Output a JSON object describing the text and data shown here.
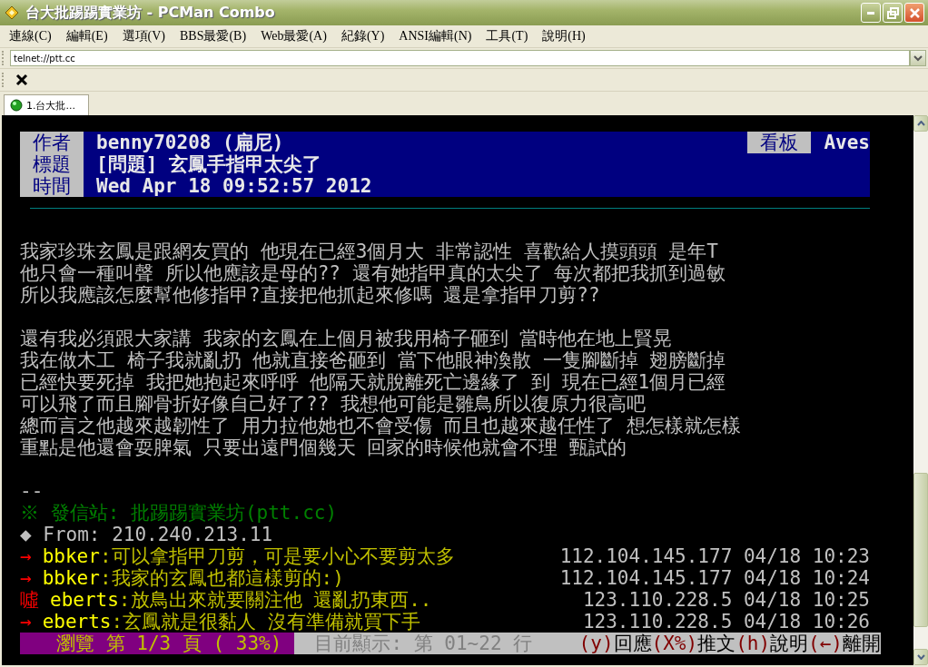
{
  "window": {
    "title": "台大批踢踢實業坊 - PCMan Combo"
  },
  "menu": [
    "連線(C)",
    "編輯(E)",
    "選項(V)",
    "BBS最愛(B)",
    "Web最愛(A)",
    "紀錄(Y)",
    "ANSI編輯(N)",
    "工具(T)",
    "說明(H)"
  ],
  "address": {
    "value": "telnet://ptt.cc"
  },
  "tabs": [
    {
      "label": "1.台大批...",
      "selected": true,
      "connected": true
    }
  ],
  "terminal": {
    "lines": [
      {
        "kind": "header",
        "left": [
          {
            "kind": "label",
            "text": "作者"
          },
          {
            "kind": "text",
            "text": "benny70208 (扁尼)"
          }
        ],
        "right": [
          {
            "kind": "label",
            "text": "看板"
          },
          {
            "kind": "text",
            "text": "Aves"
          }
        ]
      },
      {
        "kind": "header",
        "left": [
          {
            "kind": "label",
            "text": "標題"
          },
          {
            "kind": "text",
            "text": "[問題] 玄鳳手指甲太尖了"
          }
        ]
      },
      {
        "kind": "header",
        "left": [
          {
            "kind": "label",
            "text": "時間"
          },
          {
            "kind": "text",
            "text": "Wed Apr 18 09:52:57 2012"
          }
        ]
      },
      {
        "kind": "rule"
      },
      {
        "kind": "blank"
      },
      {
        "kind": "text",
        "left": [
          {
            "kind": "text",
            "text": "我家珍珠玄鳳是跟網友買的 他現在已經3個月大 非常認性 喜歡給人摸頭頭 是年T",
            "color": "#c0c0c0"
          }
        ]
      },
      {
        "kind": "text",
        "left": [
          {
            "kind": "text",
            "text": "他只會一種叫聲 所以他應該是母的?? 還有她指甲真的太尖了 每次都把我抓到過敏",
            "color": "#c0c0c0"
          }
        ]
      },
      {
        "kind": "text",
        "left": [
          {
            "kind": "text",
            "text": "所以我應該怎麼幫他修指甲?直接把他抓起來修嗎 還是拿指甲刀剪??",
            "color": "#c0c0c0"
          }
        ]
      },
      {
        "kind": "blank"
      },
      {
        "kind": "text",
        "left": [
          {
            "kind": "text",
            "text": "還有我必須跟大家講 我家的玄鳳在上個月被我用椅子砸到 當時他在地上賢晃",
            "color": "#c0c0c0"
          }
        ]
      },
      {
        "kind": "text",
        "left": [
          {
            "kind": "text",
            "text": "我在做木工 椅子我就亂扔 他就直接爸砸到 當下他眼神渙散 一隻腳斷掉 翅膀斷掉",
            "color": "#c0c0c0"
          }
        ]
      },
      {
        "kind": "text",
        "left": [
          {
            "kind": "text",
            "text": "已經快要死掉 我把她抱起來呼呼 他隔天就脫離死亡邊緣了 到 現在已經1個月已經",
            "color": "#c0c0c0"
          }
        ]
      },
      {
        "kind": "text",
        "left": [
          {
            "kind": "text",
            "text": "可以飛了而且腳骨折好像自己好了?? 我想他可能是雛鳥所以復原力很高吧",
            "color": "#c0c0c0"
          }
        ]
      },
      {
        "kind": "text",
        "left": [
          {
            "kind": "text",
            "text": "總而言之他越來越韌性了 用力拉他她也不會受傷 而且也越來越任性了 想怎樣就怎樣",
            "color": "#c0c0c0"
          }
        ]
      },
      {
        "kind": "text",
        "left": [
          {
            "kind": "text",
            "text": "重點是他還會耍脾氣 只要出遠門個幾天 回家的時候他就會不理 甄試的",
            "color": "#c0c0c0"
          }
        ]
      },
      {
        "kind": "blank"
      },
      {
        "kind": "text",
        "left": [
          {
            "kind": "text",
            "text": "--",
            "color": "#c0c0c0"
          }
        ]
      },
      {
        "kind": "text",
        "left": [
          {
            "kind": "text",
            "text": "※ 發信站: 批踢踢實業坊(ptt.cc)",
            "color": "#008000"
          }
        ]
      },
      {
        "kind": "text",
        "left": [
          {
            "kind": "text",
            "text": "◆ From: 210.240.213.11",
            "color": "#c0c0c0"
          }
        ]
      },
      {
        "kind": "text",
        "left": [
          {
            "kind": "tag",
            "text": "→",
            "color": "#ff0000"
          },
          {
            "kind": "user",
            "text": "bbker",
            "color": "#ffff00"
          },
          {
            "kind": "comment",
            "text": ":可以拿指甲刀剪，可是要小心不要剪太多",
            "color": "#c0c000"
          }
        ],
        "right": [
          {
            "kind": "text",
            "text": "112.104.145.177 04/18 10:23",
            "color": "#c0c0c0"
          }
        ]
      },
      {
        "kind": "text",
        "left": [
          {
            "kind": "tag",
            "text": "→",
            "color": "#ff0000"
          },
          {
            "kind": "user",
            "text": "bbker",
            "color": "#ffff00"
          },
          {
            "kind": "comment",
            "text": ":我家的玄鳳也都這樣剪的:)",
            "color": "#c0c000"
          }
        ],
        "right": [
          {
            "kind": "text",
            "text": "112.104.145.177 04/18 10:24",
            "color": "#c0c0c0"
          }
        ]
      },
      {
        "kind": "text",
        "left": [
          {
            "kind": "tag",
            "text": "噓",
            "color": "#ff0000"
          },
          {
            "kind": "user",
            "text": "eberts",
            "color": "#ffff00"
          },
          {
            "kind": "comment",
            "text": ":放鳥出來就要關注他 還亂扔東西..",
            "color": "#c0c000"
          }
        ],
        "right": [
          {
            "kind": "text",
            "text": "123.110.228.5 04/18 10:25",
            "color": "#c0c0c0"
          }
        ]
      },
      {
        "kind": "text",
        "left": [
          {
            "kind": "tag",
            "text": "→",
            "color": "#ff0000"
          },
          {
            "kind": "user",
            "text": "eberts",
            "color": "#ffff00"
          },
          {
            "kind": "comment",
            "text": ":玄鳳就是很黏人 沒有準備就買下手",
            "color": "#c0c000"
          }
        ],
        "right": [
          {
            "kind": "text",
            "text": "123.110.228.5 04/18 10:26",
            "color": "#c0c0c0"
          }
        ]
      },
      {
        "kind": "status",
        "left": [
          {
            "kind": "page",
            "text": "瀏覽 第 1/3 頁 ( 33%)"
          },
          {
            "kind": "text",
            "text": "目前顯示: 第 01~22 行",
            "color": "#808080"
          }
        ],
        "right": [
          {
            "kind": "key",
            "text": "(y)",
            "color": "#800000"
          },
          {
            "kind": "text",
            "text": "回應",
            "color": "#000000"
          },
          {
            "kind": "key",
            "text": "(X%)",
            "color": "#800000"
          },
          {
            "kind": "text",
            "text": "推文",
            "color": "#000000"
          },
          {
            "kind": "key",
            "text": "(h)",
            "color": "#800000"
          },
          {
            "kind": "text",
            "text": "說明",
            "color": "#000000"
          },
          {
            "kind": "key",
            "text": "(←)",
            "color": "#800000"
          },
          {
            "kind": "text",
            "text": "離開",
            "color": "#000000"
          }
        ]
      }
    ]
  }
}
